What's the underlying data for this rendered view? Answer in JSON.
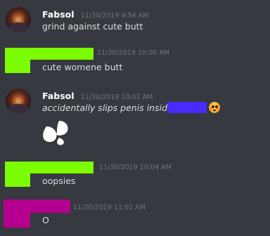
{
  "colors": {
    "background": "#36393f",
    "username": "#ffffff",
    "text": "#dcddde",
    "timestamp": "#72767d",
    "redact_green": "#7cfc00",
    "redact_blue": "#4a2bff",
    "redact_magenta": "#b5008f"
  },
  "messages": [
    {
      "username": "Fabsol",
      "timestamp": "11/30/2019 9:54 AM",
      "text": "grind against cute butt"
    },
    {
      "username_redacted": true,
      "timestamp": "11/30/2019 10:00 AM",
      "text": "cute womene butt"
    },
    {
      "username": "Fabsol",
      "timestamp": "11/30/2019 10:02 AM",
      "text": "accidentally slips penis inside",
      "emoji": "flushed-face-icon",
      "attachment_icon": "sweat-droplets-icon"
    },
    {
      "username_redacted": true,
      "timestamp": "11/30/2019 10:04 AM",
      "text": "oopsies"
    },
    {
      "username_redacted": true,
      "timestamp": "11/30/2019 11:02 AM",
      "text": "O"
    }
  ]
}
